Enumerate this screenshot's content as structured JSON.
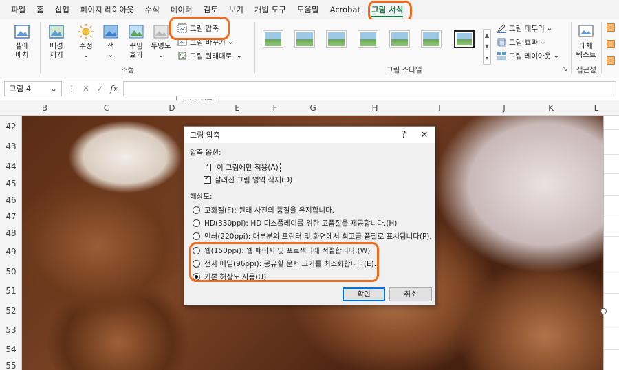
{
  "menubar": {
    "tabs": [
      "파일",
      "홈",
      "삽입",
      "페이지 레이아웃",
      "수식",
      "데이터",
      "검토",
      "보기",
      "개발 도구",
      "도움말",
      "Acrobat",
      "그림 서식"
    ],
    "active_tab": "그림 서식"
  },
  "ribbon": {
    "adjust": {
      "remove_bg": "배경\n제거",
      "corrections": "수정",
      "color": "색",
      "artistic": "꾸밈\n효과",
      "transparency": "투명도",
      "compress": "그림 압축",
      "change": "그림 바꾸기",
      "reset": "그림 원래대로",
      "group_label": "조정"
    },
    "set_bg": "셀에\n배치",
    "styles": {
      "group_label": "그림 스타일",
      "border": "그림 테두리",
      "effects": "그림 효과",
      "layout": "그림 레이아웃"
    },
    "accessibility": {
      "alt_text": "대체\n텍스트",
      "group_label": "접근성"
    }
  },
  "formula_bar": {
    "name_box": "그림 4",
    "fx": "fx",
    "tooltip": "수식 입력줄"
  },
  "columns": [
    "B",
    "C",
    "D",
    "E",
    "F",
    "G",
    "H",
    "I",
    "J",
    "K",
    "L"
  ],
  "rows": [
    "42",
    "43",
    "44",
    "45",
    "46",
    "47",
    "48",
    "49",
    "50",
    "51",
    "52",
    "53",
    "54",
    "55"
  ],
  "dialog": {
    "title": "그림 압축",
    "help": "?",
    "close": "✕",
    "compress_options_label": "압축 옵션:",
    "apply_only": "이 그림에만 적용(A)",
    "delete_cropped": "잘려진 그림 영역 삭제(D)",
    "resolution_label": "해상도:",
    "resolutions": [
      {
        "label": "고화질(F): 원래 사진의 품질을 유지합니다.",
        "checked": false
      },
      {
        "label": "HD(330ppi): HD 디스플레이를 위한 고품질을 제공합니다.(H)",
        "checked": false
      },
      {
        "label": "인쇄(220ppi): 대부분의 프린터 및 화면에서 최고급 품질로 표시됩니다(P).",
        "checked": false
      },
      {
        "label": "웹(150ppi): 웹 페이지 및 프로젝터에 적절합니다.(W)",
        "checked": false
      },
      {
        "label": "전자 메일(96ppi): 공유할 문서 크기를 최소화합니다(E).",
        "checked": false
      },
      {
        "label": "기본 해상도 사용(U)",
        "checked": true
      }
    ],
    "ok": "확인",
    "cancel": "취소"
  },
  "colors": {
    "accent": "#107c41",
    "highlight": "#f26b1d"
  }
}
